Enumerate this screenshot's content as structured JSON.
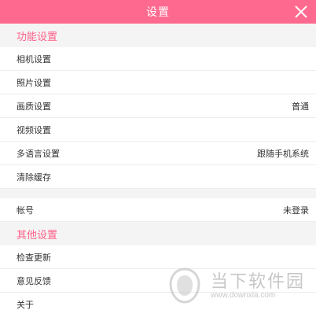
{
  "window": {
    "title": "设置",
    "close_icon": "close-icon"
  },
  "sections": [
    {
      "header": "功能设置",
      "items": [
        {
          "label": "相机设置",
          "value": ""
        },
        {
          "label": "照片设置",
          "value": ""
        },
        {
          "label": "画质设置",
          "value": "普通"
        },
        {
          "label": "视频设置",
          "value": ""
        },
        {
          "label": "多语言设置",
          "value": "跟随手机系统"
        },
        {
          "label": "清除缓存",
          "value": ""
        }
      ]
    },
    {
      "header": "",
      "items": [
        {
          "label": "帐号",
          "value": "未登录"
        }
      ]
    },
    {
      "header": "其他设置",
      "items": [
        {
          "label": "检查更新",
          "value": ""
        },
        {
          "label": "意见反馈",
          "value": ""
        },
        {
          "label": "关于",
          "value": ""
        }
      ]
    }
  ],
  "watermark": {
    "text": "当下软件园",
    "url": "www.downxia.com"
  },
  "colors": {
    "accent": "#fe6a8f",
    "section_text": "#fe5f89",
    "background": "#f4f4f4"
  }
}
